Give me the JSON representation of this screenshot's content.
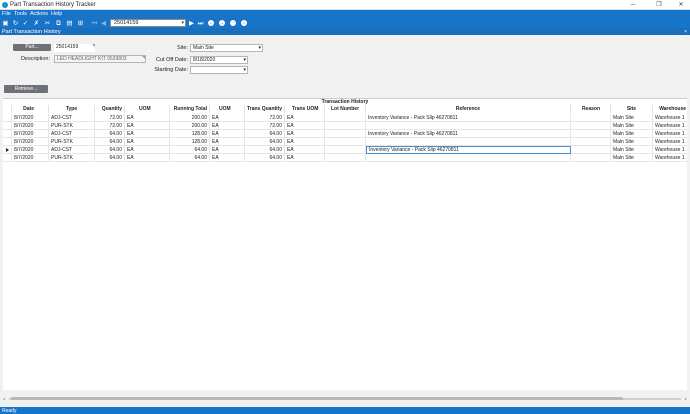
{
  "window": {
    "title": "Part Transaction History Tracker",
    "minimize": "─",
    "maximize": "❐",
    "close": "✕"
  },
  "menu": [
    "File",
    "Tools",
    "Actions",
    "Help"
  ],
  "toolbar": {
    "part_value": "25014159",
    "combo_arrow": "▾"
  },
  "tab": {
    "label": "Part Transaction History",
    "close": "×"
  },
  "form": {
    "part_button": "Part...",
    "part_value": "25014159",
    "description_label": "Description:",
    "description_value": "LED HEADLIGHT KIT 0539803",
    "site_label": "Site:",
    "site_value": "Main Site",
    "cutoff_label": "Cut Off Date:",
    "cutoff_value": "8/18/2020",
    "starting_label": "Starting Date:",
    "starting_value": "",
    "retrieve_button": "Retrieve..."
  },
  "grid": {
    "group_title": "Transaction History",
    "columns": [
      "Date",
      "Type",
      "Quantity",
      "UOM",
      "Running Total",
      "UOM",
      "Trans Quantity",
      "Trans UOM",
      "Lot Number",
      "Reference",
      "Reason",
      "Site",
      "Warehouse"
    ],
    "rows": [
      [
        "8/7/2020",
        "ADJ-CST",
        "72.00",
        "EA",
        "200.00",
        "EA",
        "72.00",
        "EA",
        "",
        "Inventory Variance - Pack Slip 46270811",
        "",
        "Main Site",
        "Warehouse 1"
      ],
      [
        "8/7/2020",
        "PUR-STK",
        "72.00",
        "EA",
        "200.00",
        "EA",
        "72.00",
        "EA",
        "",
        "",
        "",
        "Main Site",
        "Warehouse 1"
      ],
      [
        "8/7/2020",
        "ADJ-CST",
        "64.00",
        "EA",
        "128.00",
        "EA",
        "64.00",
        "EA",
        "",
        "Inventory Variance - Pack Slip 46270811",
        "",
        "Main Site",
        "Warehouse 1"
      ],
      [
        "8/7/2020",
        "PUR-STK",
        "64.00",
        "EA",
        "128.00",
        "EA",
        "64.00",
        "EA",
        "",
        "",
        "",
        "Main Site",
        "Warehouse 1"
      ],
      [
        "8/7/2020",
        "ADJ-CST",
        "64.00",
        "EA",
        "64.00",
        "EA",
        "64.00",
        "EA",
        "",
        "Inventory Variance - Pack Slip 46270811",
        "",
        "Main Site",
        "Warehouse 1"
      ],
      [
        "8/7/2020",
        "PUR-STK",
        "64.00",
        "EA",
        "64.00",
        "EA",
        "64.00",
        "EA",
        "",
        "",
        "",
        "Main Site",
        "Warehouse 1"
      ]
    ]
  },
  "status": "Ready"
}
